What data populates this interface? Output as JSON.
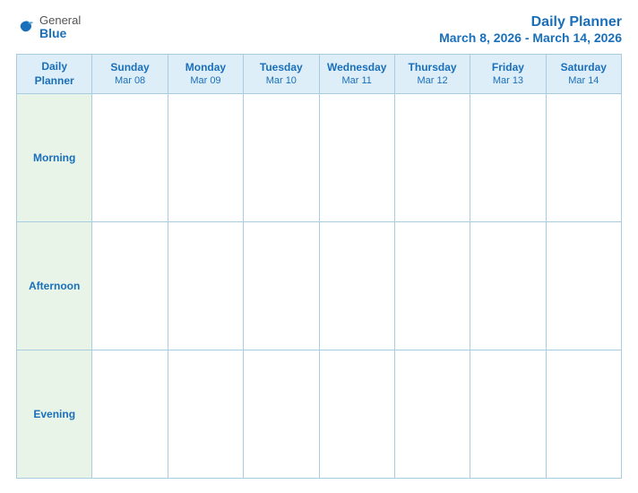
{
  "header": {
    "logo": {
      "general": "General",
      "blue": "Blue"
    },
    "title": "Daily Planner",
    "date_range": "March 8, 2026 - March 14, 2026"
  },
  "table": {
    "header_label_line1": "Daily",
    "header_label_line2": "Planner",
    "columns": [
      {
        "day": "Sunday",
        "date": "Mar 08"
      },
      {
        "day": "Monday",
        "date": "Mar 09"
      },
      {
        "day": "Tuesday",
        "date": "Mar 10"
      },
      {
        "day": "Wednesday",
        "date": "Mar 11"
      },
      {
        "day": "Thursday",
        "date": "Mar 12"
      },
      {
        "day": "Friday",
        "date": "Mar 13"
      },
      {
        "day": "Saturday",
        "date": "Mar 14"
      }
    ],
    "rows": [
      {
        "label": "Morning"
      },
      {
        "label": "Afternoon"
      },
      {
        "label": "Evening"
      }
    ]
  }
}
